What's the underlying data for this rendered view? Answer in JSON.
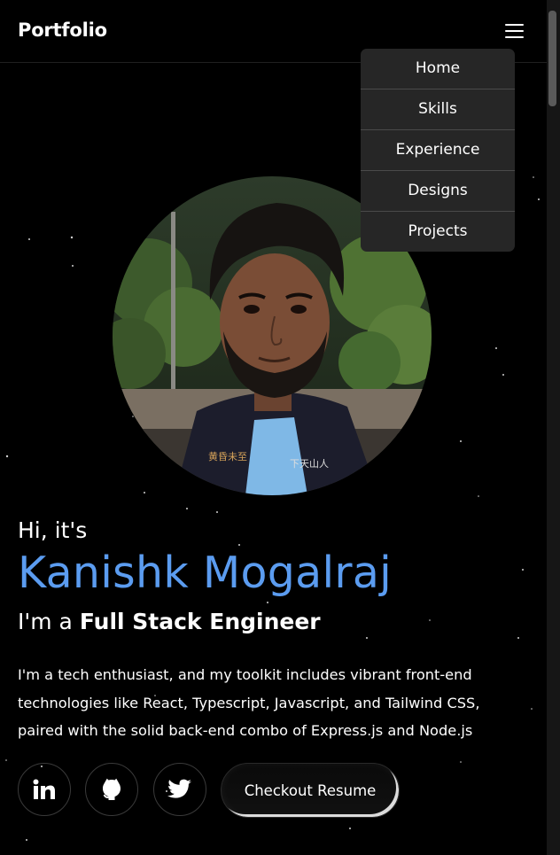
{
  "header": {
    "brand": "Portfolio",
    "menu_icon": "hamburger-menu-icon"
  },
  "nav_menu": {
    "items": [
      {
        "label": "Home"
      },
      {
        "label": "Skills"
      },
      {
        "label": "Experience"
      },
      {
        "label": "Designs"
      },
      {
        "label": "Projects"
      }
    ]
  },
  "hero": {
    "greeting": "Hi, it's",
    "name": "Kanishk Mogalraj",
    "role_prefix": "I'm a ",
    "role": "Full Stack Engineer",
    "bio": "I'm a tech enthusiast, and my toolkit includes vibrant front-end technologies like React, Typescript, Javascript, and Tailwind CSS, paired with the solid back-end combo of Express.js and Node.js",
    "name_color": "#5b9cf0"
  },
  "social": [
    {
      "icon": "linkedin-icon"
    },
    {
      "icon": "github-icon"
    },
    {
      "icon": "twitter-icon"
    }
  ],
  "resume_button": {
    "label": "Checkout Resume"
  }
}
